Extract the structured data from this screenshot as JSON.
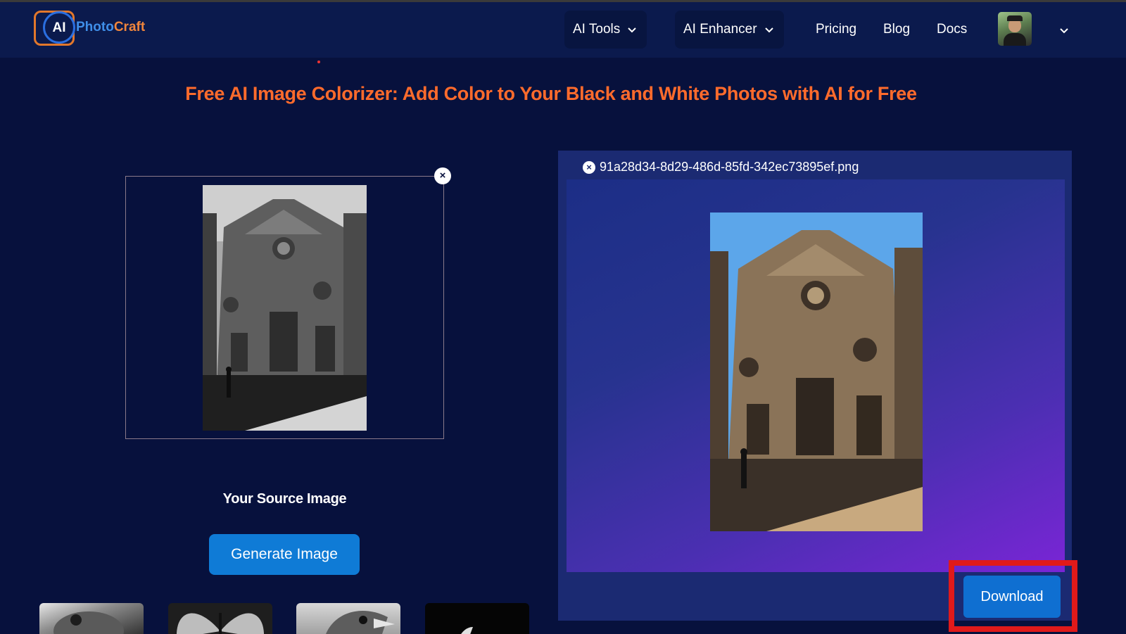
{
  "brand": {
    "logo_mark": "AI",
    "logo_word_1": "Photo",
    "logo_word_2": "Craft"
  },
  "nav": {
    "ai_tools": "AI Tools",
    "ai_enhancer": "AI Enhancer",
    "pricing": "Pricing",
    "blog": "Blog",
    "docs": "Docs"
  },
  "main": {
    "title": "Free AI Image Colorizer: Add Color to Your Black and White Photos with AI for Free",
    "source_label": "Your Source Image",
    "generate_button": "Generate Image",
    "close_glyph": "×"
  },
  "result": {
    "file_name": "91a28d34-8d29-486d-85fd-342ec73895ef.png",
    "download_button": "Download"
  },
  "icons": {
    "chevron": "chevron-down-icon",
    "close": "close-icon"
  },
  "colors": {
    "background": "#07113d",
    "header": "#0b1a4d",
    "title": "#ff6b2c",
    "primary_button": "#0f7bd6",
    "highlight": "#e01a1a",
    "result_panel": "#1b2a72"
  }
}
